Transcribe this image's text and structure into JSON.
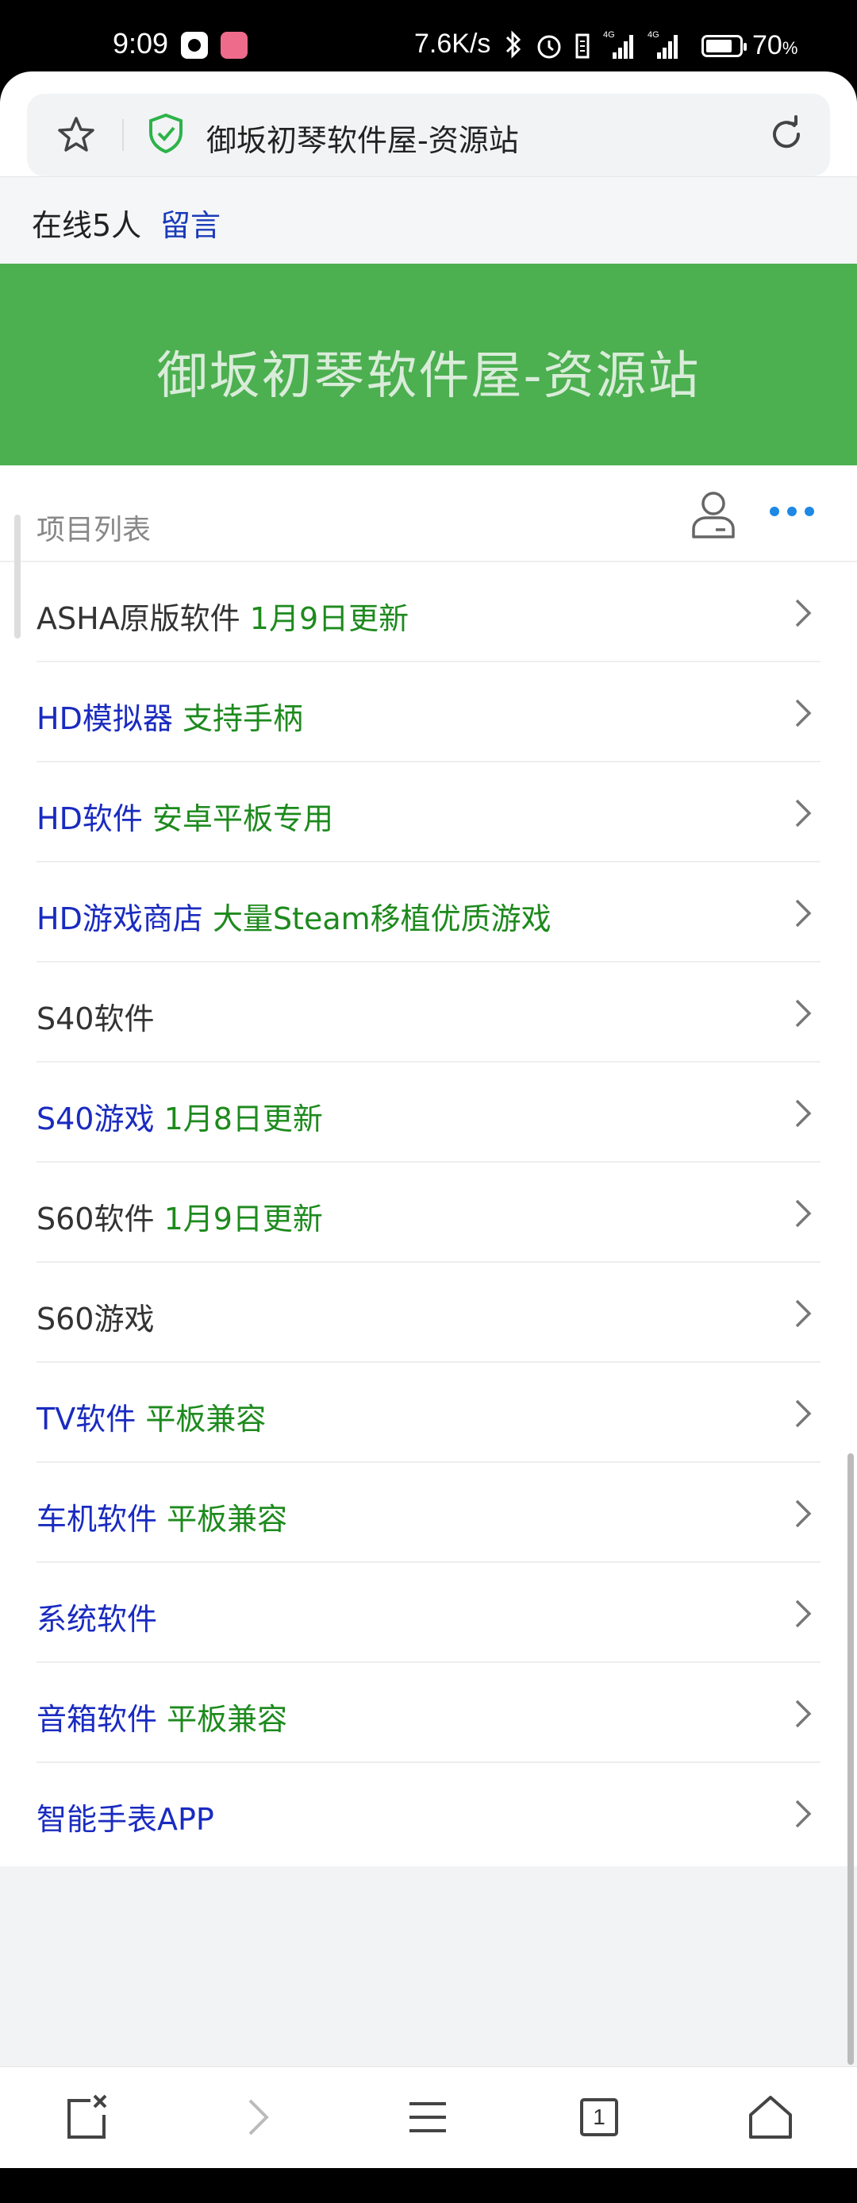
{
  "status_bar": {
    "time": "9:09",
    "net_speed": "7.6K/s",
    "status_icons": [
      "bluetooth-icon",
      "alarm-icon",
      "vibrate-icon",
      "signal-4g-icon",
      "signal-4g-icon"
    ],
    "signal_label": "4G",
    "battery_percent": "70",
    "battery_unit": "%"
  },
  "browser": {
    "page_title": "御坂初琴软件屋-资源站",
    "icons": {
      "star": "star-icon",
      "secure": "shield-check-icon",
      "reload": "reload-icon"
    }
  },
  "online": {
    "text": "在线5人",
    "message_link": "留言"
  },
  "banner": {
    "title": "御坂初琴软件屋-资源站",
    "color": "#4caf50"
  },
  "list": {
    "header": "项目列表",
    "items": [
      {
        "main": "ASHA原版软件",
        "extra": "1月9日更新",
        "style": "dark"
      },
      {
        "main": "HD模拟器",
        "extra": "支持手柄",
        "style": "blue"
      },
      {
        "main": "HD软件",
        "extra": "安卓平板专用",
        "style": "blue"
      },
      {
        "main": "HD游戏商店",
        "extra": "大量Steam移植优质游戏",
        "style": "blue"
      },
      {
        "main": "S40软件",
        "extra": "",
        "style": "dark"
      },
      {
        "main": "S40游戏",
        "extra": "1月8日更新",
        "style": "blue"
      },
      {
        "main": "S60软件",
        "extra": "1月9日更新",
        "style": "dark"
      },
      {
        "main": "S60游戏",
        "extra": "",
        "style": "dark"
      },
      {
        "main": "TV软件",
        "extra": "平板兼容",
        "style": "blue"
      },
      {
        "main": "车机软件",
        "extra": "平板兼容",
        "style": "blue"
      },
      {
        "main": "系统软件",
        "extra": "",
        "style": "blue"
      },
      {
        "main": "音箱软件",
        "extra": "平板兼容",
        "style": "blue"
      },
      {
        "main": "智能手表APP",
        "extra": "",
        "style": "blue"
      }
    ]
  },
  "bottom_nav": {
    "tab_count": "1"
  },
  "colors": {
    "link_blue": "#1a2bc0",
    "extra_green": "#1d8a1d",
    "more_blue": "#1e88e5"
  }
}
